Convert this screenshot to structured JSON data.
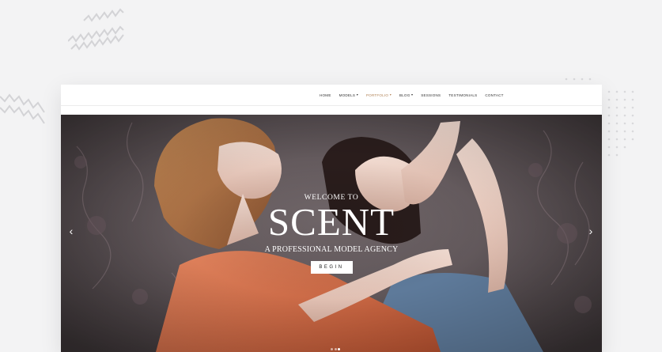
{
  "nav": {
    "items": [
      {
        "label": "HOME",
        "caret": ""
      },
      {
        "label": "MODELS",
        "caret": "▾"
      },
      {
        "label": "PORTFOLIO",
        "caret": "▾"
      },
      {
        "label": "BLOG",
        "caret": "▾"
      },
      {
        "label": "SESSIONS",
        "caret": ""
      },
      {
        "label": "TESTIMONIALS",
        "caret": ""
      },
      {
        "label": "CONTACT",
        "caret": ""
      }
    ],
    "active_item": "PORTFOLIO",
    "active_color": "#b3855a"
  },
  "hero": {
    "welcome": "WELCOME TO",
    "brand": "SCENT",
    "tagline": "A PROFESSIONAL MODEL AGENCY",
    "cta_label": "BEGIN",
    "prev_arrow": "‹",
    "next_arrow": "›",
    "slides_count": 3,
    "active_slide": 3
  },
  "icons": {
    "prev": "chevron-left-icon",
    "next": "chevron-right-icon"
  },
  "colors": {
    "page_bg": "#f3f3f4",
    "hero_overlay": "#524a4d",
    "text_light": "#ffffff"
  }
}
